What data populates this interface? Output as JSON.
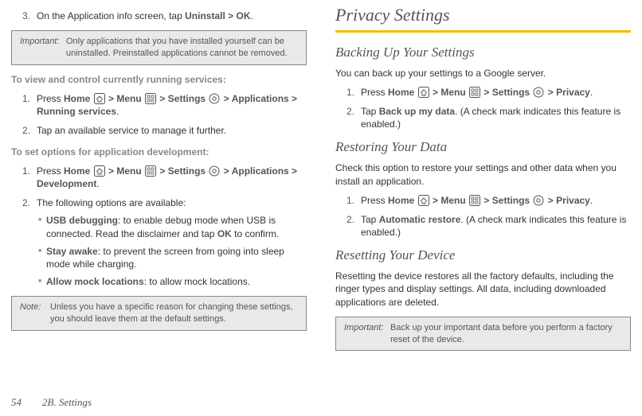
{
  "left": {
    "step3_pre": "On the Application info screen, tap ",
    "step3_b1": "Uninstall",
    "step3_gt": " > ",
    "step3_b2": "OK",
    "step3_post": ".",
    "important_label": "Important:",
    "important_body": "Only applications that you have installed yourself can be uninstalled. Preinstalled applications cannot be removed.",
    "hdr_running": "To view and control currently running services:",
    "run1_pre": "Press ",
    "home_lbl": "Home",
    "menu_lbl": "Menu",
    "settings_lbl": "Settings",
    "run1_tail": "Applications > Running services",
    "run2": "Tap an available service to manage it further.",
    "hdr_dev": "To set options for application development:",
    "dev1_tail": "Applications > Development",
    "dev2": "The following options are available:",
    "usb_b": "USB debugging",
    "usb_body": ": to enable debug mode when USB is connected. Read the disclaimer and tap ",
    "ok_b": "OK",
    "usb_post": " to confirm.",
    "stay_b": "Stay awake",
    "stay_body": ": to prevent the screen from going into sleep mode while charging.",
    "mock_b": "Allow mock locations",
    "mock_body": ": to allow mock locations.",
    "note_label": "Note:",
    "note_body": "Unless you have a specific reason for changing these settings, you should leave them at the default settings."
  },
  "right": {
    "h1": "Privacy Settings",
    "h2a": "Backing Up Your Settings",
    "back_intro": "You can back up your settings to a Google server.",
    "back_tail": "Privacy",
    "back2_b": "Back up my data",
    "back2_body": ". (A check mark indicates this feature is enabled.)",
    "h2b": "Restoring Your Data",
    "rest_intro": "Check this option to restore your settings and other data when you install an application.",
    "rest2_b": "Automatic restore",
    "rest2_body": ". (A check mark indicates this feature is enabled.)",
    "h2c": "Resetting Your Device",
    "reset_body": "Resetting the device restores all the factory defaults, including the ringer types and display settings. All data, including downloaded applications are deleted.",
    "important_label": "Important:",
    "important_body": "Back up your important data before you perform a factory reset of the device."
  },
  "footer": {
    "page": "54",
    "section": "2B. Settings"
  },
  "nums": {
    "n1": "1.",
    "n2": "2.",
    "n3": "3."
  }
}
